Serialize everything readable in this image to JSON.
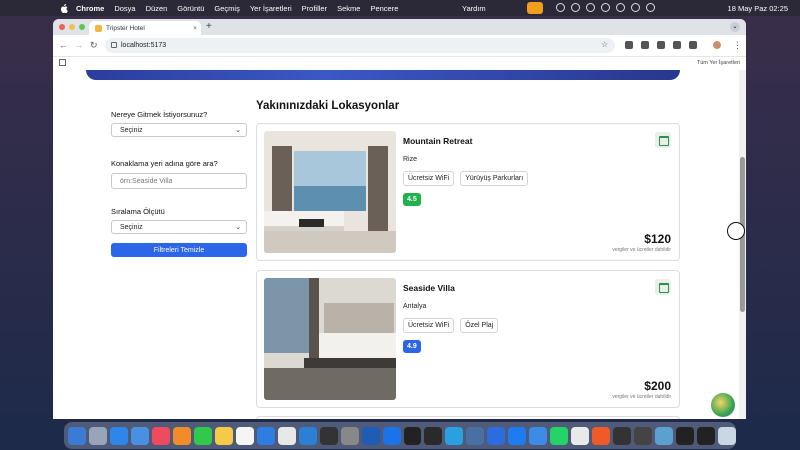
{
  "menubar": {
    "app": "Chrome",
    "items": [
      "Dosya",
      "Düzen",
      "Görüntü",
      "Geçmiş",
      "Yer İşaretleri",
      "Profiller",
      "Sekme",
      "Pencere"
    ],
    "help": "Yardım",
    "clock": "18 May Paz  02:25"
  },
  "browser": {
    "tab_title": "Tripster Hotel",
    "url": "localhost:5173",
    "bookmarks_all": "Tüm Yer İşaretleri"
  },
  "sidebar": {
    "destination_label": "Nereye Gitmek İstiyorsunuz?",
    "destination_value": "Seçiniz",
    "search_label": "Konaklama yeri adına göre ara?",
    "search_placeholder": "örn:Seaside Villa",
    "sort_label": "Sıralama Ölçütü",
    "sort_value": "Seçiniz",
    "clear_button": "Filtreleri Temizle"
  },
  "main": {
    "heading": "Yakınınızdaki Lokasyonlar",
    "hotels": [
      {
        "name": "Mountain Retreat",
        "city": "Rize",
        "amenities": [
          "Ücretsiz WiFi",
          "Yürüyüş Parkurları"
        ],
        "rating": "4.5",
        "rating_color": "#22b24c",
        "price": "$120",
        "tax_note": "vergiler ve ücretler dahildir"
      },
      {
        "name": "Seaside Villa",
        "city": "Antalya",
        "amenities": [
          "Ücretsiz WiFi",
          "Özel Plaj"
        ],
        "rating": "4.9",
        "rating_color": "#2c66e8",
        "price": "$200",
        "tax_note": "vergiler ve ücretler dahildir"
      }
    ]
  }
}
